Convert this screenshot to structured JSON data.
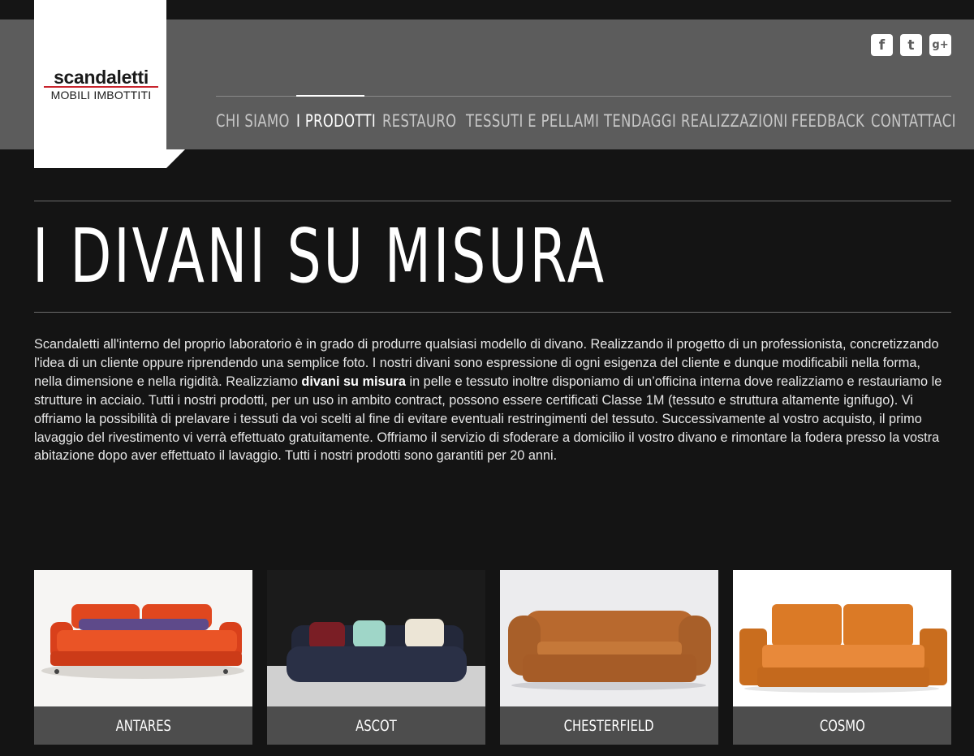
{
  "brand": {
    "name": "scandaletti",
    "tagline": "MOBILI IMBOTTITI"
  },
  "social": [
    {
      "icon": "facebook-icon",
      "glyph": "f"
    },
    {
      "icon": "twitter-icon",
      "glyph": "t"
    },
    {
      "icon": "googleplus-icon",
      "glyph": "g+"
    }
  ],
  "nav": {
    "items": [
      "CHI SIAMO",
      "I PRODOTTI",
      "RESTAURO",
      "TESSUTI E PELLAMI",
      "TENDAGGI",
      "REALIZZAZIONI",
      "FEEDBACK",
      "CONTATTACI"
    ],
    "active": "I PRODOTTI"
  },
  "page": {
    "title": "I DIVANI SU MISURA",
    "intro_before": "Scandaletti all'interno del proprio laboratorio è in grado di produrre qualsiasi modello di divano. Realizzando il progetto di un professionista, concretizzando l'idea di un cliente oppure riprendendo una semplice foto. I nostri divani  sono espressione di ogni esigenza del cliente e dunque modificabili nella forma, nella dimensione e nella rigidità. Realizziamo ",
    "intro_bold": "divani su misura",
    "intro_after": " in pelle e tessuto inoltre disponiamo di un’officina interna dove realizziamo e restauriamo le strutture in acciaio. Tutti i nostri prodotti, per un uso in ambito contract, possono essere certificati Classe 1M (tessuto e struttura altamente ignifugo). Vi offriamo la possibilità di prelavare i tessuti da voi scelti al fine di evitare eventuali restringimenti del tessuto. Successivamente al vostro acquisto, il primo lavaggio del rivestimento vi verrà effettuato gratuitamente. Offriamo il servizio di sfoderare a domicilio il vostro divano e rimontare la fodera presso la vostra abitazione dopo aver effettuato il lavaggio. Tutti i nostri prodotti sono garantiti per 20 anni."
  },
  "products": [
    {
      "name": "ANTARES",
      "color": "#e0471f"
    },
    {
      "name": "ASCOT",
      "color": "#23283a"
    },
    {
      "name": "CHESTERFIELD",
      "color": "#b8692e"
    },
    {
      "name": "COSMO",
      "color": "#db7a26"
    }
  ]
}
